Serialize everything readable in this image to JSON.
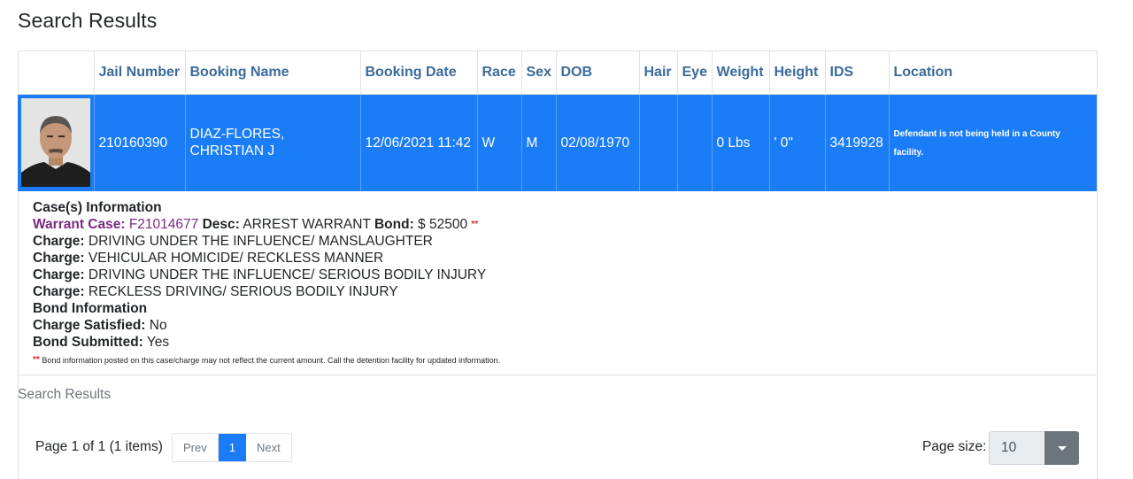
{
  "page": {
    "title": "Search Results"
  },
  "table": {
    "headers": [
      "",
      "Jail Number",
      "Booking Name",
      "Booking Date",
      "Race",
      "Sex",
      "DOB",
      "Hair",
      "Eye",
      "Weight",
      "Height",
      "IDS",
      "Location"
    ],
    "rows": [
      {
        "photo_alt": "Booking photo",
        "jail_number": "210160390",
        "booking_name": "DIAZ-FLORES, CHRISTIAN J",
        "booking_date": "12/06/2021 11:42",
        "race": "W",
        "sex": "M",
        "dob": "02/08/1970",
        "hair": "",
        "eye": "",
        "weight": "0 Lbs",
        "height": "' 0\"",
        "ids": "3419928",
        "location": "Defendant is not being held in a County facility."
      }
    ]
  },
  "details": {
    "cases_heading": "Case(s) Information",
    "warrant_case_label": "Warrant Case:",
    "warrant_case_value": "F21014677",
    "desc_label": "Desc:",
    "desc_value": "ARREST WARRANT",
    "bond_label": "Bond:",
    "bond_value": "$ 52500",
    "asterisks": "**",
    "charge_label": "Charge:",
    "charges": [
      "DRIVING UNDER THE INFLUENCE/ MANSLAUGHTER",
      "VEHICULAR HOMICIDE/ RECKLESS MANNER",
      "DRIVING UNDER THE INFLUENCE/ SERIOUS BODILY INJURY",
      "RECKLESS DRIVING/ SERIOUS BODILY INJURY"
    ],
    "bond_heading": "Bond Information",
    "charge_satisfied_label": "Charge Satisfied:",
    "charge_satisfied_value": "No",
    "bond_submitted_label": "Bond Submitted:",
    "bond_submitted_value": "Yes",
    "note": "Bond information posted on this case/charge may not reflect the current amount. Call the detention facility for updated information."
  },
  "footer": {
    "caption": "Search Results",
    "page_info": "Page 1 of 1 (1 items)",
    "prev_label": "Prev",
    "current_page": "1",
    "next_label": "Next",
    "page_size_label": "Page size:",
    "page_size_value": "10"
  },
  "colors": {
    "header_text": "#3b6a9a",
    "selected_row": "#1a7cf6",
    "warrant_text": "#7b2a7f",
    "asterisk": "#d62828"
  }
}
